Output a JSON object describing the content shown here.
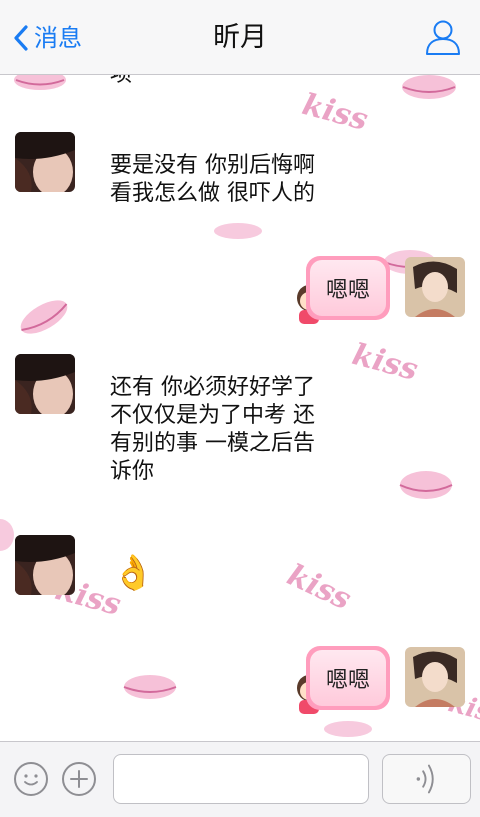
{
  "nav": {
    "back_label": "消息",
    "title": "昕月"
  },
  "chat": {
    "partial_text": "项",
    "messages": [
      {
        "side": "left",
        "text": "要是没有 你别后悔啊\n看我怎么做 很吓人的"
      },
      {
        "side": "right",
        "text": "嗯嗯"
      },
      {
        "side": "left",
        "text": "还有 你必须好好学了\n不仅仅是为了中考 还\n有别的事 一模之后告\n诉你"
      },
      {
        "side": "left",
        "text": "👌"
      },
      {
        "side": "right",
        "text": "嗯嗯"
      }
    ],
    "kiss_text": "kiss"
  },
  "input_bar": {
    "text_value": ""
  },
  "colors": {
    "accent": "#1a7cf3",
    "bubble_pink": "#ff9dbd"
  }
}
